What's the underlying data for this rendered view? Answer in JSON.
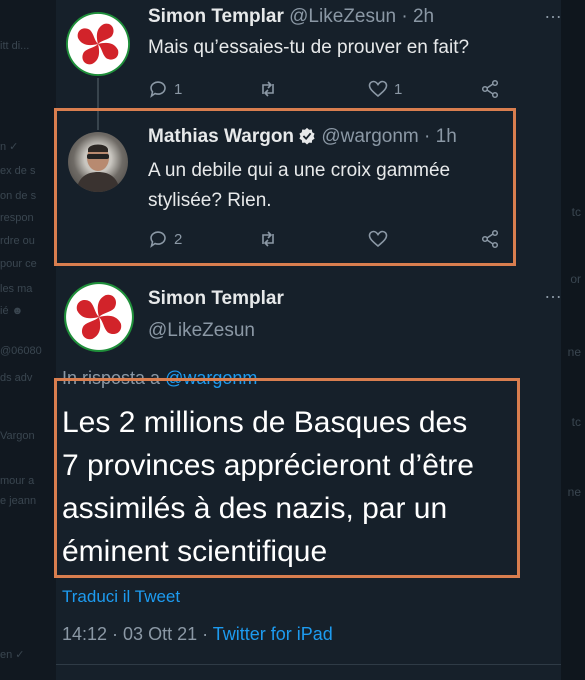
{
  "tweet1": {
    "name": "Simon Templar",
    "handle": "@LikeZesun",
    "time": "2h",
    "text": "Mais qu’essaies-tu de prouver en fait?",
    "replies": "1",
    "likes": "1"
  },
  "tweet2": {
    "name": "Mathias Wargon",
    "handle": "@wargonm",
    "time": "1h",
    "text_line1": "A un debile qui a une croix gammée",
    "text_line2": "stylisée? Rien.",
    "replies": "2"
  },
  "tweet3": {
    "name": "Simon Templar",
    "handle": "@LikeZesun",
    "reply_prefix": "In risposta a",
    "reply_handle": "@wargonm",
    "text_line1": "Les 2 millions de Basques des",
    "text_line2": "7 provinces apprécieront d’être",
    "text_line3": "assimilés à des nazis, par un",
    "text_line4": "éminent scientifique",
    "translate": "Traduci il Tweet",
    "time": "14:12 · 03 Ott 21 ·",
    "source": "Twitter for iPad"
  },
  "more_icon": "…",
  "icons": [
    "reply-icon",
    "retweet-icon",
    "like-icon",
    "share-icon",
    "verified-badge-icon",
    "more-icon",
    "ikurrina-avatar"
  ],
  "colors": {
    "highlight": "#d97e4f",
    "accent": "#1d9bf0",
    "background": "#16202a",
    "muted": "#8b98a5"
  }
}
